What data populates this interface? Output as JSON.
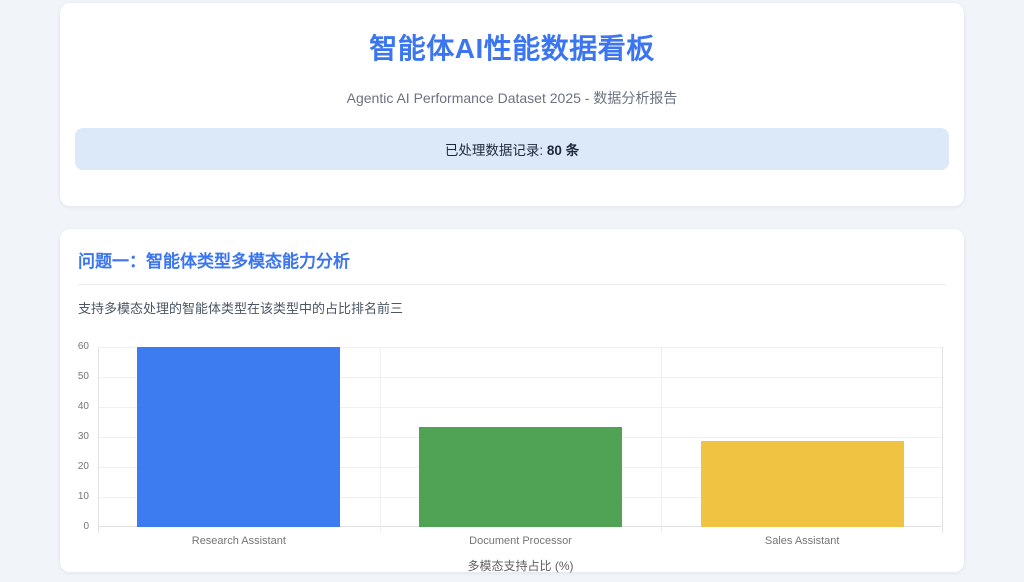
{
  "page": {
    "background_color": "#f1f4f8",
    "accent_blue": "#3b76f0"
  },
  "header": {
    "title": "智能体AI性能数据看板",
    "subtitle": "Agentic AI Performance Dataset 2025 - 数据分析报告",
    "badge": {
      "label": "已处理数据记录:",
      "count": "80",
      "unit": "条",
      "background_color": "#dce9f8"
    }
  },
  "question": {
    "heading": "问题一：智能体类型多模态能力分析",
    "description": "支持多模态处理的智能体类型在该类型中的占比排名前三"
  },
  "chart_data": {
    "type": "bar",
    "categories": [
      "Research Assistant",
      "Document Processor",
      "Sales Assistant"
    ],
    "values": [
      60,
      33.3,
      28.6
    ],
    "bar_colors": [
      "#3d7bf0",
      "#50a355",
      "#f1c343"
    ],
    "title": "",
    "xlabel": "多模态支持占比 (%)",
    "ylabel": "",
    "ylim": [
      0,
      60
    ],
    "yticks": [
      0,
      10,
      20,
      30,
      40,
      50,
      60
    ],
    "grid": true,
    "legend": false,
    "bar_width_fraction": 0.72
  }
}
